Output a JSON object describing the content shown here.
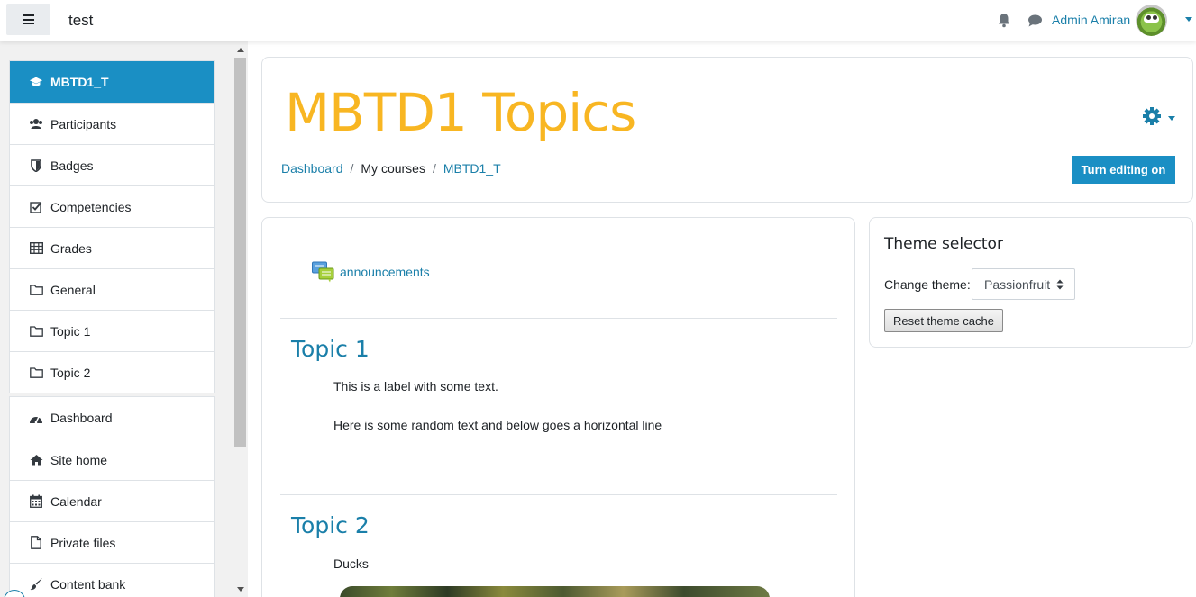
{
  "navbar": {
    "site_name": "test",
    "user_name": "Admin Amiran"
  },
  "drawer": {
    "course_items": [
      {
        "label": "MBTD1_T",
        "icon": "graduation-cap-icon"
      },
      {
        "label": "Participants",
        "icon": "users-icon"
      },
      {
        "label": "Badges",
        "icon": "shield-icon"
      },
      {
        "label": "Competencies",
        "icon": "check-square-icon"
      },
      {
        "label": "Grades",
        "icon": "table-icon"
      },
      {
        "label": "General",
        "icon": "folder-icon"
      },
      {
        "label": "Topic 1",
        "icon": "folder-icon"
      },
      {
        "label": "Topic 2",
        "icon": "folder-icon"
      }
    ],
    "site_items": [
      {
        "label": "Dashboard",
        "icon": "dashboard-icon"
      },
      {
        "label": "Site home",
        "icon": "home-icon"
      },
      {
        "label": "Calendar",
        "icon": "calendar-icon"
      },
      {
        "label": "Private files",
        "icon": "file-icon"
      },
      {
        "label": "Content bank",
        "icon": "paintbrush-icon"
      }
    ]
  },
  "header": {
    "title": "MBTD1 Topics",
    "breadcrumb": [
      "Dashboard",
      "My courses",
      "MBTD1_T"
    ],
    "edit_button": "Turn editing on"
  },
  "course": {
    "announcements": "announcements",
    "topics": [
      {
        "title": "Topic 1",
        "lines": [
          "This is a label with some text.",
          "Here is some random text and below goes a horizontal line"
        ]
      },
      {
        "title": "Topic 2",
        "lines": [
          "Ducks"
        ]
      }
    ]
  },
  "theme_selector": {
    "title": "Theme selector",
    "label": "Change theme:",
    "selected": "Passionfruit",
    "reset_button": "Reset theme cache"
  },
  "colors": {
    "accent": "#1a8fc4",
    "link": "#1a7fa9",
    "title": "#f8b622"
  }
}
